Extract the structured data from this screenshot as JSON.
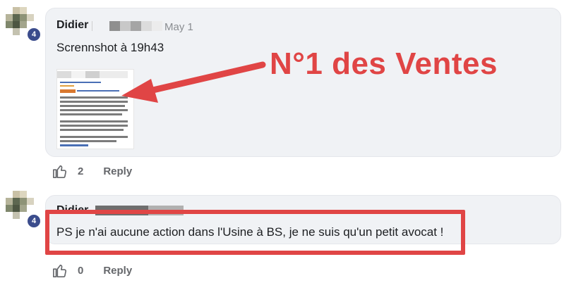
{
  "comments": [
    {
      "author": "Didier",
      "date": "May 1",
      "badge": "4",
      "text": "Scrennshot à 19h43",
      "likes": "2",
      "reply_label": "Reply"
    },
    {
      "author": "Didier",
      "badge": "4",
      "text": "PS je n'ai aucune action dans l'Usine à BS, je ne suis qu'un petit avocat !",
      "likes": "0",
      "reply_label": "Reply"
    }
  ],
  "annotation": {
    "headline": "N°1 des Ventes",
    "color": "#e04545"
  },
  "icons": [
    "thumbs-up-icon",
    "arrow-icon"
  ]
}
